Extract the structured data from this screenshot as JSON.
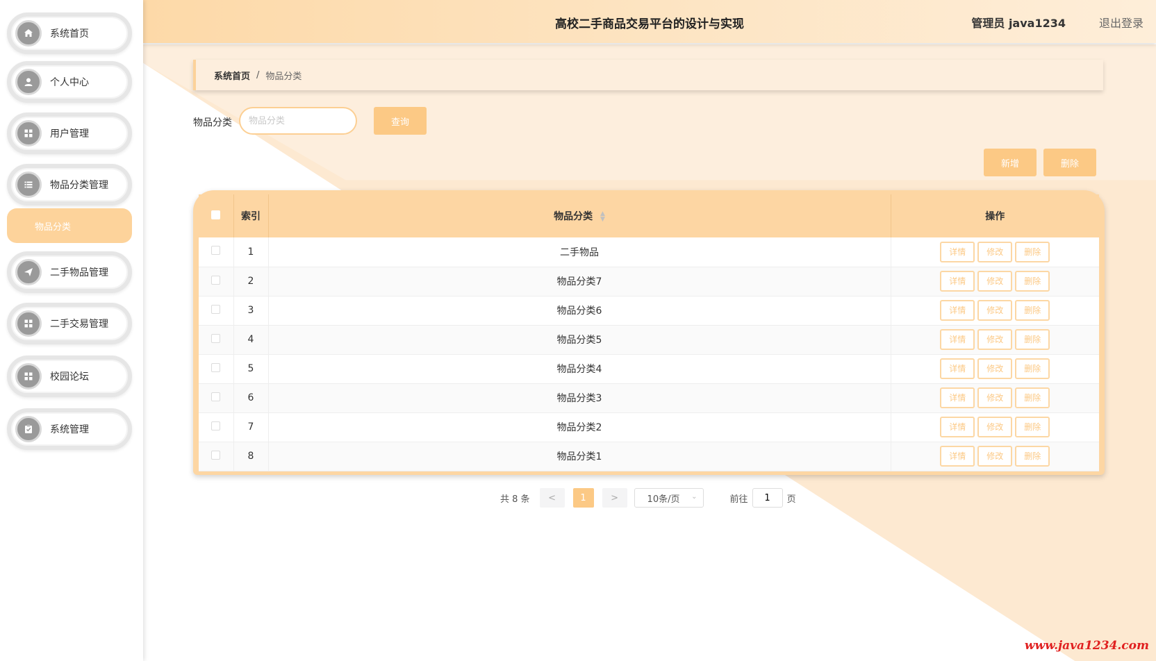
{
  "app": {
    "title": "高校二手商品交易平台的设计与实现",
    "user": "管理员 java1234",
    "logout": "退出登录"
  },
  "sidebar": {
    "items": [
      {
        "label": "系统首页",
        "icon": "home-icon"
      },
      {
        "label": "个人中心",
        "icon": "user-icon"
      },
      {
        "label": "用户管理",
        "icon": "grid-icon"
      },
      {
        "label": "物品分类管理",
        "icon": "list-icon"
      },
      {
        "label": "二手物品管理",
        "icon": "send-icon"
      },
      {
        "label": "二手交易管理",
        "icon": "grid-icon"
      },
      {
        "label": "校园论坛",
        "icon": "grid-icon"
      },
      {
        "label": "系统管理",
        "icon": "clipboard-icon"
      }
    ],
    "sub_active": "物品分类"
  },
  "breadcrumb": {
    "home": "系统首页",
    "sep": "/",
    "current": "物品分类"
  },
  "search": {
    "label": "物品分类",
    "placeholder": "物品分类",
    "button": "查询"
  },
  "actions": {
    "add": "新增",
    "delete": "删除"
  },
  "table": {
    "headers": {
      "index": "索引",
      "category": "物品分类",
      "ops": "操作"
    },
    "op_labels": {
      "detail": "详情",
      "edit": "修改",
      "delete": "删除"
    },
    "rows": [
      {
        "index": "1",
        "category": "二手物品"
      },
      {
        "index": "2",
        "category": "物品分类7"
      },
      {
        "index": "3",
        "category": "物品分类6"
      },
      {
        "index": "4",
        "category": "物品分类5"
      },
      {
        "index": "5",
        "category": "物品分类4"
      },
      {
        "index": "6",
        "category": "物品分类3"
      },
      {
        "index": "7",
        "category": "物品分类2"
      },
      {
        "index": "8",
        "category": "物品分类1"
      }
    ]
  },
  "pager": {
    "total": "共 8 条",
    "prev": "<",
    "current": "1",
    "next": ">",
    "page_size": "10条/页",
    "goto_label": "前往",
    "goto_value": "1",
    "page_suffix": "页"
  },
  "watermark": "www.java1234.com",
  "colors": {
    "accent": "#fcc985",
    "header": "#fdd9a8",
    "sub_active": "#fdd39b"
  }
}
